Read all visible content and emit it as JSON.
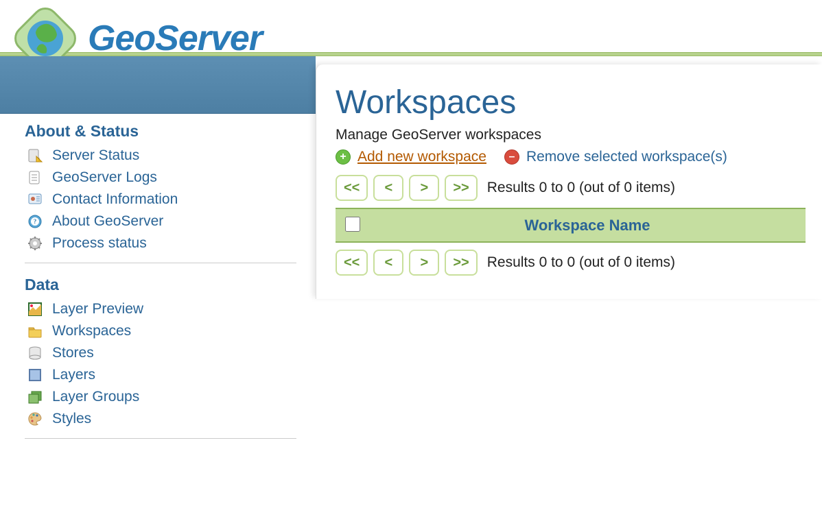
{
  "brand": {
    "name": "GeoServer"
  },
  "sidebar": {
    "sections": [
      {
        "title": "About & Status",
        "items": [
          {
            "label": "Server Status",
            "icon": "server-status-icon"
          },
          {
            "label": "GeoServer Logs",
            "icon": "logs-icon"
          },
          {
            "label": "Contact Information",
            "icon": "contact-icon"
          },
          {
            "label": "About GeoServer",
            "icon": "about-icon"
          },
          {
            "label": "Process status",
            "icon": "process-icon"
          }
        ]
      },
      {
        "title": "Data",
        "items": [
          {
            "label": "Layer Preview",
            "icon": "layer-preview-icon"
          },
          {
            "label": "Workspaces",
            "icon": "workspaces-icon"
          },
          {
            "label": "Stores",
            "icon": "stores-icon"
          },
          {
            "label": "Layers",
            "icon": "layers-icon"
          },
          {
            "label": "Layer Groups",
            "icon": "layer-groups-icon"
          },
          {
            "label": "Styles",
            "icon": "styles-icon"
          }
        ]
      }
    ]
  },
  "main": {
    "title": "Workspaces",
    "subtitle": "Manage GeoServer workspaces",
    "actions": {
      "add": "Add new workspace",
      "remove": "Remove selected workspace(s)"
    },
    "pager": {
      "first": "<<",
      "prev": "<",
      "next": ">",
      "last": ">>",
      "results": "Results 0 to 0 (out of 0 items)"
    },
    "table": {
      "columns": {
        "name": "Workspace Name"
      },
      "rows": []
    }
  }
}
